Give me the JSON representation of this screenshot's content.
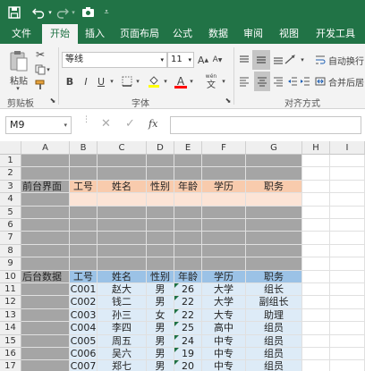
{
  "quick_access": {
    "save_icon": "save-icon",
    "undo_icon": "undo-icon",
    "redo_icon": "redo-icon",
    "camera_icon": "camera-icon",
    "menu_icon": "customize-icon"
  },
  "tabs": [
    "文件",
    "开始",
    "插入",
    "页面布局",
    "公式",
    "数据",
    "审阅",
    "视图",
    "开发工具"
  ],
  "active_tab": "开始",
  "ribbon": {
    "paste_label": "粘贴",
    "clipboard_label": "剪贴板",
    "font_name": "等线",
    "font_size": "11",
    "font_group_label": "字体",
    "align_group_label": "对齐方式",
    "wrap_text": "自动换行",
    "merge_center": "合并后居",
    "bold": "B",
    "italic": "I",
    "underline": "U",
    "grow_font": "A",
    "shrink_font": "A",
    "font_color_letter": "A",
    "wen": "wén",
    "wen_char": "文"
  },
  "formula_bar": {
    "name_box": "M9",
    "fx": "fx",
    "formula": ""
  },
  "columns": [
    "A",
    "B",
    "C",
    "D",
    "E",
    "F",
    "G",
    "H",
    "I"
  ],
  "rows": [
    "1",
    "2",
    "3",
    "4",
    "5",
    "6",
    "7",
    "8",
    "9",
    "10",
    "11",
    "12",
    "13",
    "14",
    "15",
    "16",
    "17"
  ],
  "sheet": {
    "front_label": "前台界面",
    "back_label": "后台数据",
    "headers": [
      "工号",
      "姓名",
      "性别",
      "年龄",
      "学历",
      "职务"
    ],
    "records": [
      [
        "C001",
        "赵大",
        "男",
        "26",
        "大学",
        "组长"
      ],
      [
        "C002",
        "钱二",
        "男",
        "22",
        "大学",
        "副组长"
      ],
      [
        "C003",
        "孙三",
        "女",
        "22",
        "大专",
        "助理"
      ],
      [
        "C004",
        "李四",
        "男",
        "25",
        "高中",
        "组员"
      ],
      [
        "C005",
        "周五",
        "男",
        "24",
        "中专",
        "组员"
      ],
      [
        "C006",
        "吴六",
        "男",
        "19",
        "中专",
        "组员"
      ],
      [
        "C007",
        "郑七",
        "男",
        "20",
        "中专",
        "组员"
      ]
    ]
  },
  "colors": {
    "excel_green": "#217346",
    "gray_fill": "#a5a5a5",
    "orange_header": "#f8cbad",
    "pink_row": "#fce4d6",
    "blue_header": "#9bc2e6",
    "blue_row": "#ddebf7"
  }
}
